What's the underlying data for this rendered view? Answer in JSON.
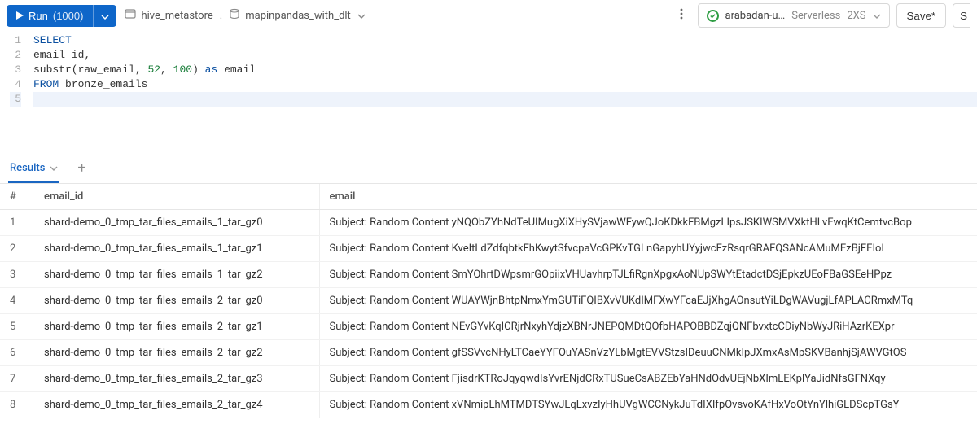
{
  "toolbar": {
    "run_label": "Run",
    "run_count": "(1000)",
    "catalog": "hive_metastore",
    "separator": ".",
    "table": "mapinpandas_with_dlt",
    "cluster_name": "arabadan-u…",
    "cluster_type": "Serverless",
    "cluster_size": "2XS",
    "save_label": "Save*",
    "share_initial": "S"
  },
  "editor": {
    "lines": [
      {
        "n": "1",
        "content": [
          [
            "kw",
            "SELECT"
          ]
        ]
      },
      {
        "n": "2",
        "content": [
          [
            "ident",
            "email_id,"
          ]
        ]
      },
      {
        "n": "3",
        "content": [
          [
            "ident",
            "substr(raw_email, "
          ],
          [
            "num",
            "52"
          ],
          [
            "ident",
            ", "
          ],
          [
            "num",
            "100"
          ],
          [
            "ident",
            ") "
          ],
          [
            "kw",
            "as"
          ],
          [
            "ident",
            " email"
          ]
        ]
      },
      {
        "n": "4",
        "content": [
          [
            "kw",
            "FROM"
          ],
          [
            "ident",
            " bronze_emails"
          ]
        ]
      },
      {
        "n": "5",
        "content": [
          [
            "ident",
            ""
          ]
        ],
        "active": true
      }
    ]
  },
  "tabs": {
    "results_label": "Results"
  },
  "results": {
    "header_row_index": "#",
    "columns": [
      "email_id",
      "email"
    ],
    "rows": [
      {
        "n": "1",
        "email_id": "shard-demo_0_tmp_tar_files_emails_1_tar_gz0",
        "email": "Subject: Random Content yNQObZYhNdTeUIMugXiXHySVjawWFywQJoKDkkFBMgzLIpsJSKIWSMVXktHLvEwqKtCemtvcBop"
      },
      {
        "n": "2",
        "email_id": "shard-demo_0_tmp_tar_files_emails_1_tar_gz1",
        "email": "Subject: Random Content KveItLdZdfqbtkFhKwytSfvcpaVcGPKvTGLnGapyhUYyjwcFzRsqrGRAFQSANcAMuMEzBjFEIoI"
      },
      {
        "n": "3",
        "email_id": "shard-demo_0_tmp_tar_files_emails_1_tar_gz2",
        "email": "Subject: Random Content SmYOhrtDWpsmrGOpiixVHUavhrpTJLfiRgnXpgxAoNUpSWYtEtadctDSjEpkzUEoFBaGSEeHPpz"
      },
      {
        "n": "4",
        "email_id": "shard-demo_0_tmp_tar_files_emails_2_tar_gz0",
        "email": "Subject: Random Content WUAYWjnBhtpNmxYmGUTiFQIBXvVUKdIMFXwYFcaEJjXhgAOnsutYiLDgWAVugjLfAPLACRmxMTq"
      },
      {
        "n": "5",
        "email_id": "shard-demo_0_tmp_tar_files_emails_2_tar_gz1",
        "email": "Subject: Random Content NEvGYvKqICRjrNxyhYdjzXBNrJNEPQMDtQOfbHAPOBBDZqjQNFbvxtcCDiyNbWyJRiHAzrKEXpr"
      },
      {
        "n": "6",
        "email_id": "shard-demo_0_tmp_tar_files_emails_2_tar_gz2",
        "email": "Subject: Random Content gfSSVvcNHyLTCaeYYFOuYASnVzYLbMgtEVVStzsIDeuuCNMkIpJXmxAsMpSKVBanhjSjAWVGtOS"
      },
      {
        "n": "7",
        "email_id": "shard-demo_0_tmp_tar_files_emails_2_tar_gz3",
        "email": "Subject: Random Content FjisdrKTRoJqyqwdIsYvrENjdCRxTUSueCsABZEbYaHNdOdvUEjNbXImLEKplYaJidNfsGFNXqy"
      },
      {
        "n": "8",
        "email_id": "shard-demo_0_tmp_tar_files_emails_2_tar_gz4",
        "email": "Subject: Random Content xVNmipLhMTMDTSYwJLqLxvzIyHhUVgWCCNykJuTdIXIfpOvsvoKAfHxVoOtYnYlhiGLDScpTGsY"
      }
    ]
  }
}
